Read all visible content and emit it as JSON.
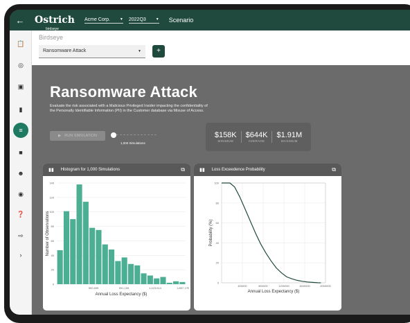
{
  "topbar": {
    "back_icon": "arrow-left-icon",
    "logo": "Ostrich",
    "logo_sub": "birdseye",
    "company": "Acme Corp.",
    "period": "2022Q3",
    "scenario": "Scenario"
  },
  "sidebar": {
    "icons": [
      "clipboard-icon",
      "radar-icon",
      "monitor-icon",
      "bar-chart-icon",
      "scenario-icon",
      "document-icon",
      "users-icon",
      "account-icon",
      "help-icon",
      "exit-icon",
      "chevron-right-icon"
    ],
    "active_index": 4
  },
  "header": {
    "title": "Birdseye",
    "scenario_select": "Ransomware Attack",
    "add_label": "+"
  },
  "main": {
    "title": "Ransomware Attack",
    "description": "Evaluate the risk associated with a Malicious Privileged Insider impacting the confidentiality of the Personally Identifiable Information (PII) in the Customer database via Misuse of Access.",
    "run_button": "RUN SIMULATION",
    "slider_label": "1,000 Simulations",
    "stats": [
      {
        "value": "$158K",
        "label": "MINIMUM"
      },
      {
        "value": "$644K",
        "label": "AVERAGE"
      },
      {
        "value": "$1.91M",
        "label": "MAXIMUM"
      }
    ]
  },
  "chart_data": [
    {
      "type": "bar",
      "title": "Histogram for 1,000 Simulations",
      "xlabel": "Annual Loss Expectancy ($)",
      "ylabel": "Number of Observations",
      "ylim": [
        0,
        140
      ],
      "yticks": [
        0,
        20,
        40,
        60,
        80,
        100,
        120,
        140
      ],
      "xtick_labels": [
        "592,699",
        "991,155",
        "1,423,614",
        "1,857,17€"
      ],
      "values": [
        47,
        101,
        90,
        138,
        114,
        78,
        75,
        55,
        48,
        32,
        37,
        28,
        26,
        15,
        12,
        8,
        10,
        2,
        4,
        3
      ],
      "color": "#4caf93"
    },
    {
      "type": "line",
      "title": "Loss Exceedence Probability",
      "xlabel": "Annual Loss Expectancy ($)",
      "ylabel": "Probability (%)",
      "xlim": [
        0,
        2000000
      ],
      "ylim": [
        0,
        100
      ],
      "yticks": [
        0,
        20,
        40,
        60,
        80,
        100
      ],
      "xticks": [
        400000,
        800000,
        1200000,
        1600000,
        2000000
      ],
      "x": [
        0,
        100000,
        158000,
        250000,
        350000,
        450000,
        550000,
        650000,
        750000,
        850000,
        950000,
        1050000,
        1150000,
        1250000,
        1350000,
        1450000,
        1550000,
        1650000,
        1750000,
        1850000,
        1910000
      ],
      "y": [
        100,
        100,
        100,
        96,
        86,
        74,
        62,
        50,
        39,
        30,
        22,
        15,
        10,
        6,
        4,
        2.5,
        1.5,
        0.8,
        0.4,
        0.1,
        0
      ],
      "color": "#1f4a3d"
    }
  ]
}
